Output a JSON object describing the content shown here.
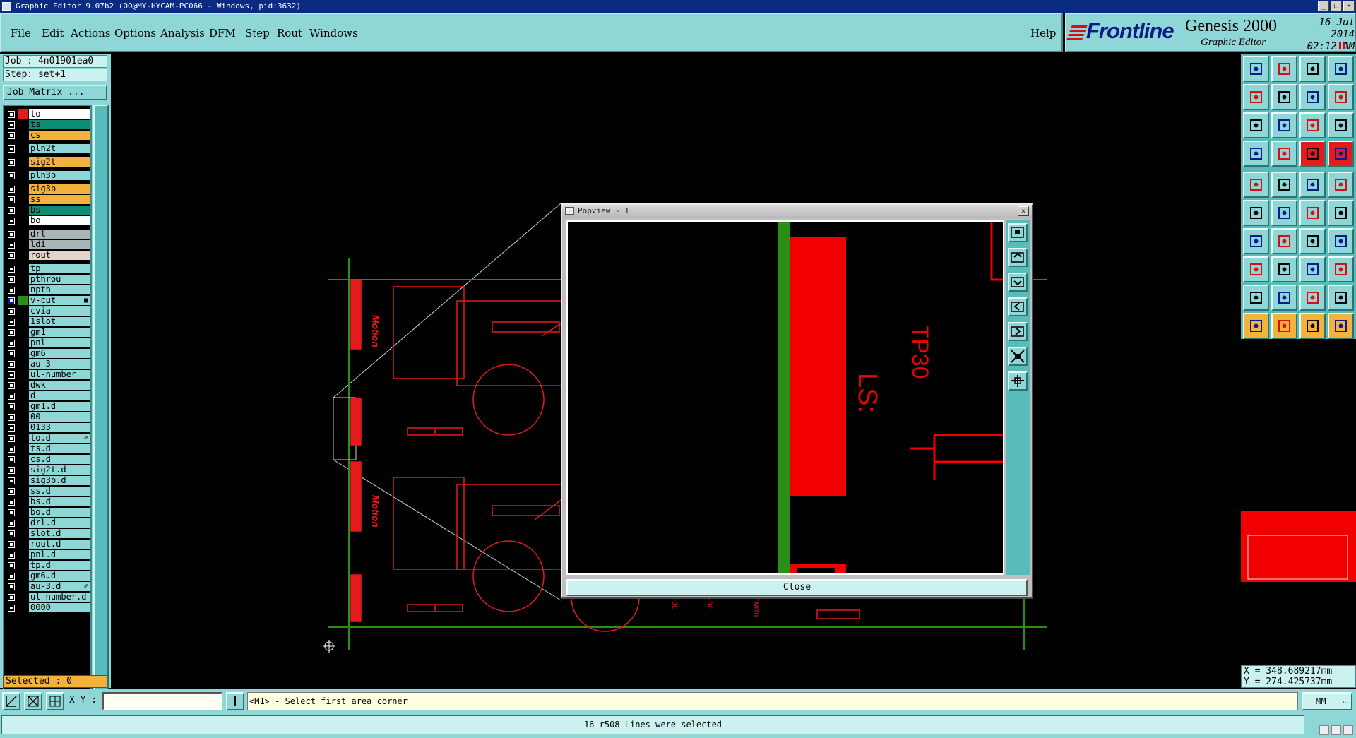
{
  "window": {
    "title": "Graphic Editor 9.07b2 (OO@MY-HYCAM-PC066 - Windows, pid:3632)",
    "controls": [
      "_",
      "□",
      "×"
    ]
  },
  "menu": {
    "items": [
      "File",
      "Edit",
      "Actions",
      "Options",
      "Analysis",
      "DFM",
      "Step",
      "Rout",
      "Windows"
    ],
    "help": "Help"
  },
  "brand": {
    "logo": "Frontline",
    "product": "Genesis 2000",
    "subtitle": "Graphic Editor",
    "date": "16 Jul 2014",
    "time": "02:12 AM"
  },
  "job": {
    "job_label": "Job : 4n01901ea0",
    "step_label": "Step: set+1",
    "matrix_button": "Job Matrix ..."
  },
  "layers": [
    {
      "name": "to",
      "color": "#ffffff",
      "swatch": "#e31b1b",
      "gap": false
    },
    {
      "name": "ts",
      "color": "#0e8d74",
      "swatch": "#000000",
      "gap": false
    },
    {
      "name": "cs",
      "color": "#f3b23b",
      "swatch": "#000000",
      "gap": false
    },
    {
      "name": "pln2t",
      "color": "#8fd7d6",
      "swatch": "#000000",
      "gap": true
    },
    {
      "name": "sig2t",
      "color": "#f3b23b",
      "swatch": "#000000",
      "gap": true
    },
    {
      "name": "pln3b",
      "color": "#8fd7d6",
      "swatch": "#000000",
      "gap": true
    },
    {
      "name": "sig3b",
      "color": "#f3b23b",
      "swatch": "#000000",
      "gap": true
    },
    {
      "name": "ss",
      "color": "#f3b23b",
      "swatch": "#000000",
      "gap": false
    },
    {
      "name": "bs",
      "color": "#0e8d74",
      "swatch": "#000000",
      "gap": false
    },
    {
      "name": "bo",
      "color": "#ffffff",
      "swatch": "#000000",
      "gap": false
    },
    {
      "name": "drl",
      "color": "#a9b4b4",
      "swatch": "#000000",
      "gap": true
    },
    {
      "name": "ldi",
      "color": "#a9b4b4",
      "swatch": "#000000",
      "gap": false
    },
    {
      "name": "rout",
      "color": "#e2d4c8",
      "swatch": "#000000",
      "gap": false
    },
    {
      "name": "tp",
      "color": "#8fd7d6",
      "swatch": "#000000",
      "gap": true
    },
    {
      "name": "pthrou",
      "color": "#8fd7d6",
      "swatch": "#000000",
      "gap": false
    },
    {
      "name": "npth",
      "color": "#8fd7d6",
      "swatch": "#000000",
      "gap": false
    },
    {
      "name": "v-cut",
      "color": "#8fd7d6",
      "swatch": "#2c8d17",
      "gap": false,
      "active": true,
      "ext": "■"
    },
    {
      "name": "cvia",
      "color": "#8fd7d6",
      "swatch": "#000000",
      "gap": false
    },
    {
      "name": "1slot",
      "color": "#8fd7d6",
      "swatch": "#000000",
      "gap": false
    },
    {
      "name": "gm1",
      "color": "#8fd7d6",
      "swatch": "#000000",
      "gap": false
    },
    {
      "name": "pnl",
      "color": "#8fd7d6",
      "swatch": "#000000",
      "gap": false
    },
    {
      "name": "gm6",
      "color": "#8fd7d6",
      "swatch": "#000000",
      "gap": false
    },
    {
      "name": "au-3",
      "color": "#8fd7d6",
      "swatch": "#000000",
      "gap": false
    },
    {
      "name": "ul-number",
      "color": "#8fd7d6",
      "swatch": "#000000",
      "gap": false
    },
    {
      "name": "dwk",
      "color": "#8fd7d6",
      "swatch": "#000000",
      "gap": false
    },
    {
      "name": "d",
      "color": "#8fd7d6",
      "swatch": "#000000",
      "gap": false
    },
    {
      "name": "gm1.d",
      "color": "#8fd7d6",
      "swatch": "#000000",
      "gap": false
    },
    {
      "name": "00",
      "color": "#8fd7d6",
      "swatch": "#000000",
      "gap": false
    },
    {
      "name": "0133",
      "color": "#8fd7d6",
      "swatch": "#000000",
      "gap": false
    },
    {
      "name": "to.d",
      "color": "#8fd7d6",
      "swatch": "#000000",
      "gap": false,
      "ext": "✐"
    },
    {
      "name": "ts.d",
      "color": "#8fd7d6",
      "swatch": "#000000",
      "gap": false
    },
    {
      "name": "cs.d",
      "color": "#8fd7d6",
      "swatch": "#000000",
      "gap": false
    },
    {
      "name": "sig2t.d",
      "color": "#8fd7d6",
      "swatch": "#000000",
      "gap": false
    },
    {
      "name": "sig3b.d",
      "color": "#8fd7d6",
      "swatch": "#000000",
      "gap": false
    },
    {
      "name": "ss.d",
      "color": "#8fd7d6",
      "swatch": "#000000",
      "gap": false
    },
    {
      "name": "bs.d",
      "color": "#8fd7d6",
      "swatch": "#000000",
      "gap": false
    },
    {
      "name": "bo.d",
      "color": "#8fd7d6",
      "swatch": "#000000",
      "gap": false
    },
    {
      "name": "drl.d",
      "color": "#8fd7d6",
      "swatch": "#000000",
      "gap": false
    },
    {
      "name": "slot.d",
      "color": "#8fd7d6",
      "swatch": "#000000",
      "gap": false
    },
    {
      "name": "rout.d",
      "color": "#8fd7d6",
      "swatch": "#000000",
      "gap": false
    },
    {
      "name": "pnl.d",
      "color": "#8fd7d6",
      "swatch": "#000000",
      "gap": false
    },
    {
      "name": "tp.d",
      "color": "#8fd7d6",
      "swatch": "#000000",
      "gap": false
    },
    {
      "name": "gm6.d",
      "color": "#8fd7d6",
      "swatch": "#000000",
      "gap": false
    },
    {
      "name": "au-3.d",
      "color": "#8fd7d6",
      "swatch": "#000000",
      "gap": false,
      "ext": "✐"
    },
    {
      "name": "ul-number.d",
      "color": "#8fd7d6",
      "swatch": "#000000",
      "gap": false
    },
    {
      "name": "0000",
      "color": "#8fd7d6",
      "swatch": "#000000",
      "gap": false
    }
  ],
  "selected_label": "Selected : 0",
  "board_text": {
    "logo_top": "Motion",
    "logo_bottom": "Motion",
    "marks": [
      "~DC",
      "-DC",
      "EARTH"
    ]
  },
  "popview": {
    "title": "Popview - 1",
    "close_button": "Close",
    "labels": [
      "TP30",
      "LS:"
    ],
    "tools": [
      "zoom-window-icon",
      "zoom-in-icon",
      "zoom-out-icon",
      "pan-left-icon",
      "pan-right-icon",
      "fit-icon",
      "home-icon"
    ]
  },
  "right_tools": [
    "save-icon",
    "open-icon",
    "home-icon",
    "grid-icon",
    "undo-icon",
    "redo-icon",
    "refresh-icon",
    "snap-icon",
    "zoom-fit-icon",
    "zoom-area-icon",
    "zoom-1to1-icon",
    "help-icon",
    "measure-icon",
    "pad-icon",
    "net-icon",
    "route-icon",
    "camera-icon",
    "slope-icon",
    "dash-icon",
    "circle-icon",
    "node-icon",
    "cross-icon",
    "line-icon",
    "diag-icon",
    "angle-icon",
    "pen-icon",
    "arc-icon",
    "flip-icon",
    "point-icon",
    "dash-line-icon",
    "symbol-icon",
    "group-icon",
    "triangle-icon",
    "peak-icon",
    "trapezoid-icon",
    "mountain-icon",
    "pointer-icon",
    "pointer-select-icon",
    "pointer-move-icon",
    "pointer-edit-icon"
  ],
  "coords": {
    "x": "X = 348.689217mm",
    "y": "Y = 274.425737mm"
  },
  "statusbar": {
    "xy_label": "X Y :",
    "xy_value": "",
    "prompt": "<M1> - Select first area corner",
    "units": "MM",
    "message": "16 r508 Lines were selected"
  }
}
